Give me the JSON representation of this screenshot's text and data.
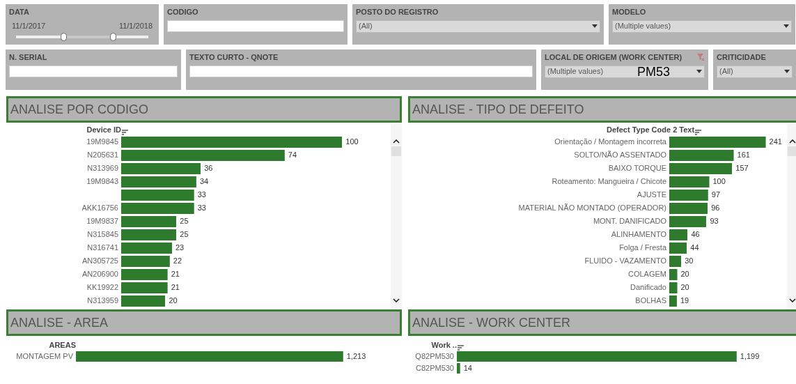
{
  "filters_row_1": [
    {
      "kind": "range",
      "label": "DATA",
      "start": "11/1/2017",
      "end": "11/1/2018",
      "handles": [
        {
          "level": 0.36
        },
        {
          "level": 0.73
        }
      ]
    },
    {
      "kind": "text",
      "label": "CODIGO"
    },
    {
      "kind": "dropdown",
      "label": "POSTO DO REGISTRO",
      "value": "(All)"
    },
    {
      "kind": "dropdown",
      "label": "MODELO",
      "value": "(Multiple values)"
    }
  ],
  "filters_row_2": [
    {
      "kind": "text",
      "label": "N. SERIAL"
    },
    {
      "kind": "text",
      "label": "TEXTO CURTO - QNOTE"
    },
    {
      "kind": "dropdown",
      "label": "LOCAL DE ORIGEM (WORK CENTER)",
      "value": "(Multiple values)",
      "annotation": "PM53",
      "filter_icon": true
    },
    {
      "kind": "dropdown",
      "label": "CRITICIDADE",
      "value": "(All)"
    }
  ],
  "sections": [
    {
      "title": "ANALISE POR CODIGO",
      "scrollbar": true,
      "sort_icon": true,
      "chart_data": {
        "type": "bar",
        "orientation": "horizontal",
        "ylabel": "Device ID",
        "data_labels": true,
        "categories": [
          "19M9845",
          "N205631",
          "N313969",
          "19M9843",
          null,
          "AKK16756",
          "19M9837",
          "N315845",
          "N316741",
          "AN305725",
          "AN206900",
          "KK19922",
          "N313959"
        ],
        "series": [
          {
            "color": "#2e7b2e",
            "values": [
              100,
              74,
              36,
              34,
              33,
              33,
              25,
              25,
              23,
              22,
              21,
              21,
              20
            ]
          }
        ]
      }
    },
    {
      "title": "ANALISE - TIPO DE DEFEITO",
      "scrollbar": true,
      "sort_icon": true,
      "chart_data": {
        "type": "bar",
        "orientation": "horizontal",
        "ylabel": "Defect Type Code 2 Text",
        "data_labels": true,
        "categories": [
          "Orientação / Montagem incorreta",
          "SOLTO/NÃO ASSENTADO",
          "BAIXO TORQUE",
          "Roteamento: Mangueira / Chicote",
          "AJUSTE",
          "MATERIAL NÃO MONTADO (OPERADOR)",
          "MONT. DANIFICADO",
          "ALINHAMENTO",
          "Folga / Fresta",
          "FLUIDO - VAZAMENTO",
          "COLAGEM",
          "Danificado",
          "BOLHAS"
        ],
        "series": [
          {
            "color": "#2e7b2e",
            "values": [
              241,
              161,
              157,
              100,
              97,
              96,
              93,
              46,
              44,
              30,
              20,
              20,
              19
            ]
          }
        ]
      }
    },
    {
      "title": "ANALISE - AREA",
      "scrollbar": false,
      "sort_icon": false,
      "chart_data": {
        "type": "bar",
        "orientation": "horizontal",
        "ylabel": "AREAS",
        "categories": [
          "MONTAGEM PV"
        ],
        "series": [
          {
            "color": "#2e7b2e",
            "values": [
              1213
            ],
            "value_labels": [
              "1,213"
            ]
          }
        ],
        "data_labels": true
      }
    },
    {
      "title": "ANALISE - WORK CENTER",
      "scrollbar": false,
      "sort_icon": true,
      "chart_data": {
        "type": "bar",
        "orientation": "horizontal",
        "ylabel": "Work ..",
        "categories": [
          "Q82PM530",
          "C82PM530"
        ],
        "series": [
          {
            "color": "#2e7b2e",
            "values": [
              1199,
              14
            ],
            "value_labels": [
              "1,199",
              "14"
            ]
          }
        ],
        "data_labels": true
      }
    }
  ]
}
